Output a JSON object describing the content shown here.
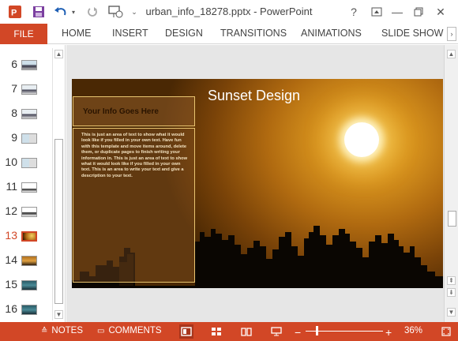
{
  "window": {
    "title": "urban_info_18278.pptx - PowerPoint",
    "controls": [
      "?",
      "—",
      "✕"
    ]
  },
  "ribbon": {
    "file": "FILE",
    "tabs": [
      "HOME",
      "INSERT",
      "DESIGN",
      "TRANSITIONS",
      "ANIMATIONS",
      "SLIDE SHOW"
    ]
  },
  "thumbnails": {
    "numbers": [
      "6",
      "7",
      "8",
      "9",
      "10",
      "11",
      "12",
      "13",
      "14",
      "15",
      "16"
    ],
    "active": "13"
  },
  "slide": {
    "title": "Sunset Design",
    "info_heading": "Your Info Goes Here",
    "info_body": "This is just an area of text to show what it would look like if you filled in your own text. Have fun with this template and move items around, delete them, or duplicate pages to finish writing your information in. This is just an area of text to show what it would look like if you filled in your own text. This is an area to write your text and give a description to your text."
  },
  "statusbar": {
    "notes": "NOTES",
    "comments": "COMMENTS",
    "zoom": "36%",
    "zoom_level": 0.36
  },
  "colors": {
    "accent": "#d24726",
    "sun": "#ffffff",
    "skyline": "#0a0602"
  }
}
